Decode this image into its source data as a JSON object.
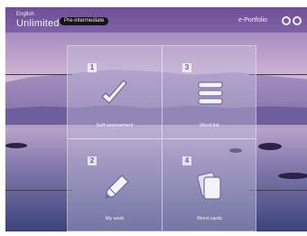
{
  "header": {
    "brand_small": "English",
    "brand_big": "Unlimited",
    "level": "Pre-intermediate",
    "portfolio": "e-Portfolio"
  },
  "menu": {
    "tiles": [
      {
        "number": "1",
        "label": "Self-assessment",
        "icon": "checkmark-icon"
      },
      {
        "number": "3",
        "label": "Word list",
        "icon": "stacked-list-icon"
      },
      {
        "number": "2",
        "label": "My work",
        "icon": "pencil-icon"
      },
      {
        "number": "4",
        "label": "Word cards",
        "icon": "cards-icon"
      }
    ]
  },
  "colors": {
    "topbar": "#7359a0",
    "badge": "#141414",
    "panel": "#c3bedc"
  }
}
